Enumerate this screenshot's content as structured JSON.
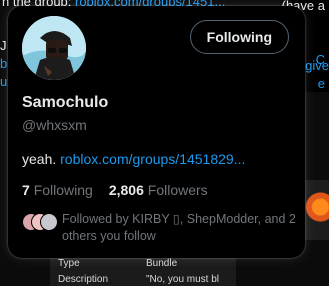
{
  "background": {
    "line1_prefix": "n the group: ",
    "line1_link": "roblox.com/groups/1451...",
    "line1_suffix": "(have a",
    "left_fragments": [
      "J",
      "b",
      "u"
    ],
    "right_fragments": [
      "C",
      "give",
      "e"
    ],
    "table_rows": [
      {
        "key": "Type",
        "value": "Bundle"
      },
      {
        "key": "Description",
        "value": "\"No, you must bl"
      }
    ]
  },
  "card": {
    "follow_button_label": "Following",
    "display_name": "Samochulo",
    "handle": "@whxsxm",
    "bio_text": "yeah. ",
    "bio_link": "roblox.com/groups/1451829...",
    "following_count": "7",
    "following_label": "Following",
    "followers_count": "2,806",
    "followers_label": "Followers",
    "followed_by_text": "Followed by KIRBY ▯, ShepModder, and 2 others you follow"
  },
  "colors": {
    "link": "#1d9bf0",
    "secondary_text": "#71767b",
    "primary_text": "#e7e9ea",
    "card_bg": "#000000"
  }
}
